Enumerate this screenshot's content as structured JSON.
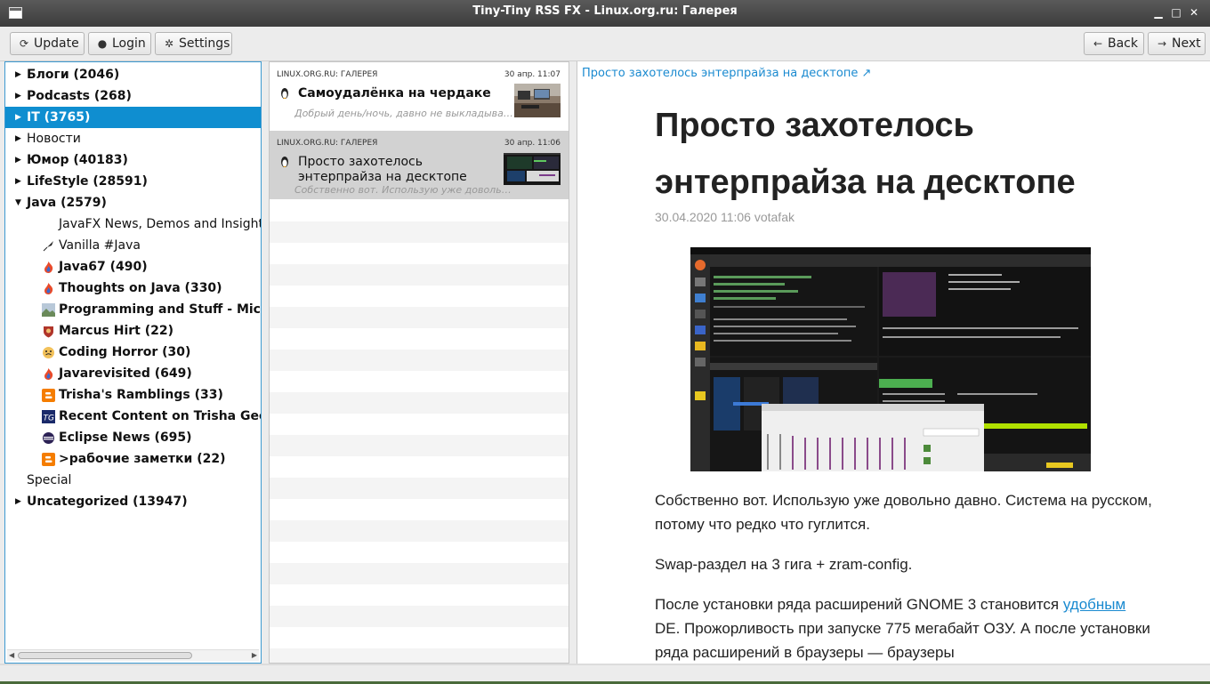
{
  "window": {
    "title": "Tiny-Tiny RSS FX - Linux.org.ru: Галерея"
  },
  "toolbar": {
    "update_label": "Update",
    "login_label": "Login",
    "settings_label": "Settings",
    "back_label": "Back",
    "next_label": "Next"
  },
  "tree": [
    {
      "label": "Блоги (2046)",
      "bold": true,
      "arrow": "right",
      "level": 0
    },
    {
      "label": "Podcasts (268)",
      "bold": true,
      "arrow": "right",
      "level": 0
    },
    {
      "label": "IT (3765)",
      "bold": true,
      "arrow": "right",
      "level": 0,
      "selected": true
    },
    {
      "label": "Новости",
      "bold": false,
      "arrow": "right",
      "level": 0
    },
    {
      "label": "Юмор (40183)",
      "bold": true,
      "arrow": "right",
      "level": 0
    },
    {
      "label": "LifeStyle (28591)",
      "bold": true,
      "arrow": "right",
      "level": 0
    },
    {
      "label": "Java (2579)",
      "bold": true,
      "arrow": "down",
      "level": 0
    },
    {
      "label": "JavaFX News, Demos and Insight // F",
      "bold": false,
      "level": 1,
      "icon": "none"
    },
    {
      "label": "Vanilla #Java",
      "bold": false,
      "level": 1,
      "icon": "quill"
    },
    {
      "label": "Java67 (490)",
      "bold": true,
      "level": 1,
      "icon": "flame"
    },
    {
      "label": "Thoughts on Java (330)",
      "bold": true,
      "level": 1,
      "icon": "flame"
    },
    {
      "label": "Programming and Stuff - Michael",
      "bold": true,
      "level": 1,
      "icon": "landscape"
    },
    {
      "label": "Marcus Hirt (22)",
      "bold": true,
      "level": 1,
      "icon": "shield"
    },
    {
      "label": "Coding Horror (30)",
      "bold": true,
      "level": 1,
      "icon": "face"
    },
    {
      "label": "Javarevisited (649)",
      "bold": true,
      "level": 1,
      "icon": "flame"
    },
    {
      "label": "Trisha's Ramblings (33)",
      "bold": true,
      "level": 1,
      "icon": "blogger"
    },
    {
      "label": "Recent Content on Trisha Gee (",
      "bold": true,
      "level": 1,
      "icon": "tg"
    },
    {
      "label": "Eclipse News (695)",
      "bold": true,
      "level": 1,
      "icon": "eclipse"
    },
    {
      "label": ">рабочие заметки (22)",
      "bold": true,
      "level": 1,
      "icon": "blogger"
    },
    {
      "label": "Special",
      "bold": false,
      "level": 0,
      "arrow": "none"
    },
    {
      "label": "Uncategorized (13947)",
      "bold": true,
      "arrow": "right",
      "level": 0
    }
  ],
  "articles": [
    {
      "feed": "LINUX.ORG.RU: ГАЛЕРЕЯ",
      "date": "30 апр. 11:07",
      "title": "Самоудалёнка на чердаке",
      "excerpt": "Добрый день/ночь, давно не выкладывал ни...",
      "bold": true,
      "selected": false
    },
    {
      "feed": "LINUX.ORG.RU: ГАЛЕРЕЯ",
      "date": "30 апр. 11:06",
      "title": "Просто захотелось энтерпрайза на десктопе",
      "excerpt": "Собственно вот. Использую уже довольно...",
      "bold": false,
      "selected": true
    }
  ],
  "reader": {
    "link_text": "Просто захотелось энтерпрайза на десктопе ↗",
    "heading": "Просто захотелось энтерпрайза на десктопе",
    "meta": "30.04.2020 11:06 votafak",
    "p1": "Собственно вот. Использую уже довольно давно. Система на русском, потому что редко что гуглится.",
    "p2": "Swap-раздел на 3 гига + zram-config.",
    "p3_before": "После установки ряда расширений GNOME 3 становится",
    "p3_link": "удобным",
    "p3_after": "DE. Прожорливость при запуске 775 мегабайт ОЗУ. А после установки ряда расширений в браузеры — браузеры"
  },
  "colors": {
    "selection": "#0f8ed0",
    "link": "#1a8ad0",
    "focus_border": "#3d9ad1"
  }
}
